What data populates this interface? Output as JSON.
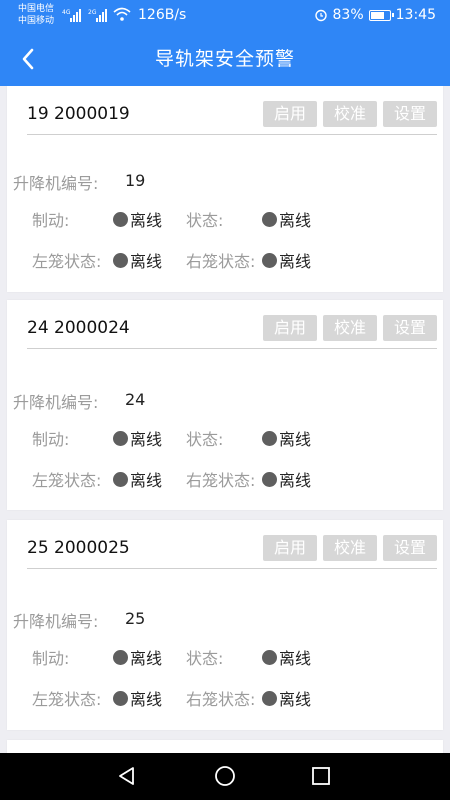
{
  "status_bar": {
    "carrier1": "中国电信",
    "carrier2": "中国移动",
    "net1": "4G",
    "net2": "2G",
    "speed": "126B/s",
    "battery": "83%",
    "battery_level": 0.83,
    "time": "13:45"
  },
  "header": {
    "title": "导轨架安全预警"
  },
  "labels": {
    "lift_no": "升降机编号:",
    "brake": "制动:",
    "state": "状态:",
    "left_cage": "左笼状态:",
    "right_cage": "右笼状态:"
  },
  "buttons": {
    "enable": "启用",
    "calibrate": "校准",
    "settings": "设置"
  },
  "cards": [
    {
      "title": "19 2000019",
      "lift_no": "19",
      "brake": "离线",
      "state": "离线",
      "left_cage": "离线",
      "right_cage": "离线"
    },
    {
      "title": "24 2000024",
      "lift_no": "24",
      "brake": "离线",
      "state": "离线",
      "left_cage": "离线",
      "right_cage": "离线"
    },
    {
      "title": "25 2000025",
      "lift_no": "25",
      "brake": "离线",
      "state": "离线",
      "left_cage": "离线",
      "right_cage": "离线"
    }
  ],
  "colors": {
    "primary": "#2f86f6",
    "button_bg": "#d7d7d7",
    "offline_dot": "#5f5f5f"
  }
}
